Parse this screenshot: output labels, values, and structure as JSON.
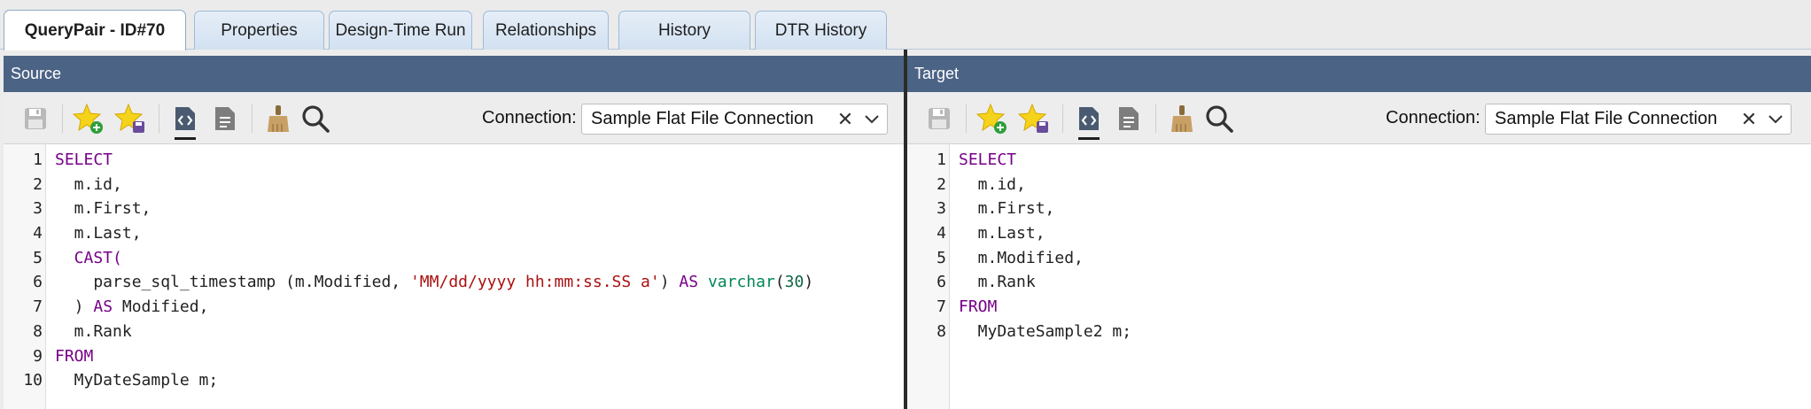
{
  "tabs": [
    {
      "label": "QueryPair - ID#70",
      "active": true
    },
    {
      "label": "Properties",
      "active": false
    },
    {
      "label": "Design-Time Run",
      "active": false
    },
    {
      "label": "Relationships",
      "active": false
    },
    {
      "label": "History",
      "active": false
    },
    {
      "label": "DTR History",
      "active": false
    }
  ],
  "toolbar_icons": [
    "save-icon",
    "add-favorite-icon",
    "save-favorite-icon",
    "source-code-icon",
    "document-icon",
    "clear-brush-icon",
    "search-icon"
  ],
  "source": {
    "title": "Source",
    "connection_label": "Connection:",
    "connection_value": "Sample Flat File Connection",
    "code_lines": [
      {
        "n": "1",
        "parts": [
          {
            "t": "SELECT",
            "c": "kw"
          }
        ]
      },
      {
        "n": "2",
        "parts": [
          {
            "t": "  m.id,",
            "c": ""
          }
        ]
      },
      {
        "n": "3",
        "parts": [
          {
            "t": "  m.First,",
            "c": ""
          }
        ]
      },
      {
        "n": "4",
        "parts": [
          {
            "t": "  m.Last,",
            "c": ""
          }
        ]
      },
      {
        "n": "5",
        "parts": [
          {
            "t": "  CAST(",
            "c": "kw"
          }
        ]
      },
      {
        "n": "6",
        "parts": [
          {
            "t": "    parse_sql_timestamp (m.Modified, ",
            "c": ""
          },
          {
            "t": "'MM/dd/yyyy hh:mm:ss.SS a'",
            "c": "str"
          },
          {
            "t": ") ",
            "c": ""
          },
          {
            "t": "AS",
            "c": "kw"
          },
          {
            "t": " ",
            "c": ""
          },
          {
            "t": "varchar",
            "c": "typ"
          },
          {
            "t": "(",
            "c": ""
          },
          {
            "t": "30",
            "c": "num"
          },
          {
            "t": ")",
            "c": ""
          }
        ]
      },
      {
        "n": "7",
        "parts": [
          {
            "t": "  ) ",
            "c": ""
          },
          {
            "t": "AS",
            "c": "kw"
          },
          {
            "t": " Modified,",
            "c": ""
          }
        ]
      },
      {
        "n": "8",
        "parts": [
          {
            "t": "  m.Rank",
            "c": ""
          }
        ]
      },
      {
        "n": "9",
        "parts": [
          {
            "t": "FROM",
            "c": "kw"
          }
        ]
      },
      {
        "n": "10",
        "parts": [
          {
            "t": "  MyDateSample m;",
            "c": ""
          }
        ]
      }
    ]
  },
  "target": {
    "title": "Target",
    "connection_label": "Connection:",
    "connection_value": "Sample Flat File Connection",
    "code_lines": [
      {
        "n": "1",
        "parts": [
          {
            "t": "SELECT",
            "c": "kw"
          }
        ]
      },
      {
        "n": "2",
        "parts": [
          {
            "t": "  m.id,",
            "c": ""
          }
        ]
      },
      {
        "n": "3",
        "parts": [
          {
            "t": "  m.First,",
            "c": ""
          }
        ]
      },
      {
        "n": "4",
        "parts": [
          {
            "t": "  m.Last,",
            "c": ""
          }
        ]
      },
      {
        "n": "5",
        "parts": [
          {
            "t": "  m.Modified,",
            "c": ""
          }
        ]
      },
      {
        "n": "6",
        "parts": [
          {
            "t": "  m.Rank",
            "c": ""
          }
        ]
      },
      {
        "n": "7",
        "parts": [
          {
            "t": "FROM",
            "c": "kw"
          }
        ]
      },
      {
        "n": "8",
        "parts": [
          {
            "t": "  MyDateSample2 m;",
            "c": ""
          }
        ]
      }
    ]
  },
  "colors": {
    "header_bar": "#4b6385",
    "keyword": "#770088",
    "string": "#aa1111",
    "type": "#008855"
  }
}
